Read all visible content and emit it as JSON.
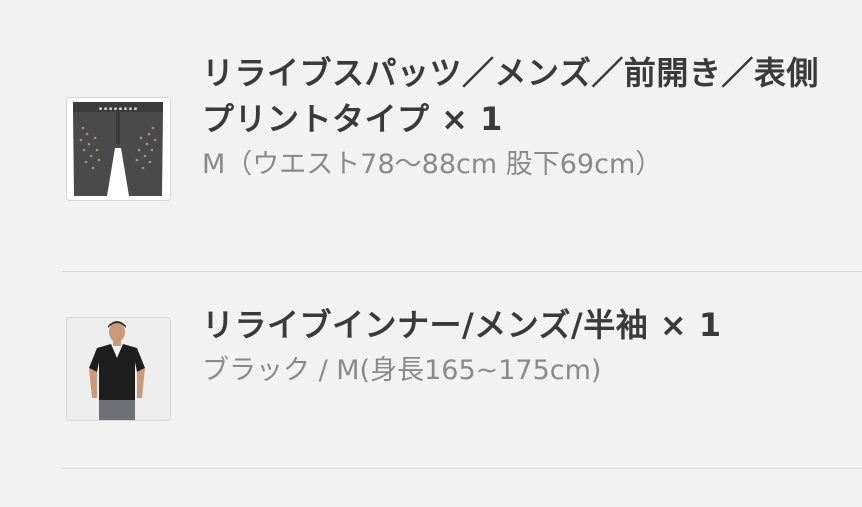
{
  "items": [
    {
      "title": "リライブスパッツ／メンズ／前開き／表側プリントタイプ × 1",
      "variant": "M（ウエスト78〜88cm 股下69cm）",
      "icon": "spats-product-image"
    },
    {
      "title": "リライブインナー/メンズ/半袖 × 1",
      "variant": "ブラック / M(身長165~175cm)",
      "icon": "inner-shirt-product-image"
    }
  ]
}
